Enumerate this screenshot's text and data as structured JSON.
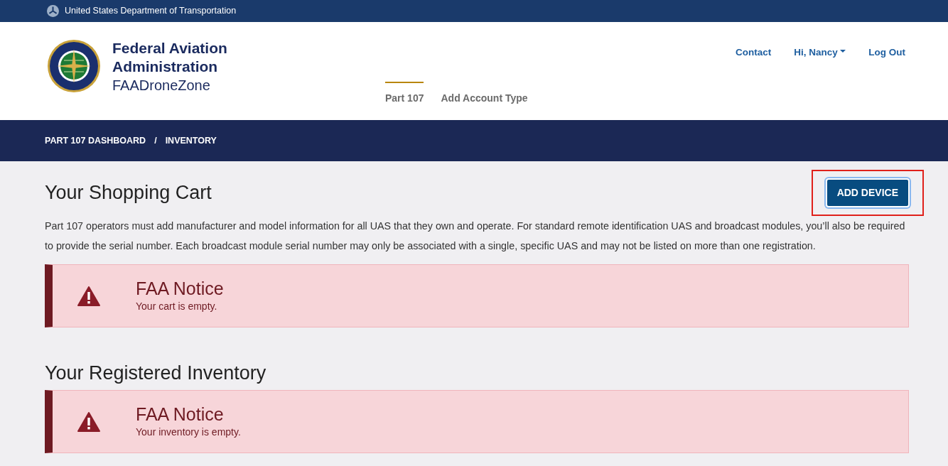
{
  "top_banner": {
    "text": "United States Department of Transportation"
  },
  "header": {
    "title_line_1": "Federal Aviation",
    "title_line_2": "Administration",
    "subtitle": "FAADroneZone",
    "utility_links": [
      {
        "label": "Contact",
        "kind": "link"
      },
      {
        "label": "Hi, Nancy",
        "kind": "dropdown"
      },
      {
        "label": "Log Out",
        "kind": "link"
      }
    ],
    "tabs": [
      {
        "label": "Part 107",
        "selected": true
      },
      {
        "label": "Add Account Type",
        "selected": false
      }
    ]
  },
  "breadcrumb": [
    {
      "label": "PART 107 DASHBOARD"
    },
    {
      "label": "INVENTORY"
    }
  ],
  "breadcrumb_separator": "/",
  "shopping_cart": {
    "heading": "Your Shopping Cart",
    "button": {
      "label": "ADD DEVICE",
      "highlighted": true
    },
    "description": "Part 107 operators must add manufacturer and model information for all UAS that they own and operate. For standard remote identification UAS and broadcast modules, you’ll also be required to provide the serial number. Each broadcast module serial number may only be associated with a single, specific UAS and may not be listed on more than one registration.",
    "notice": {
      "title": "FAA Notice",
      "message": "Your cart is empty."
    }
  },
  "registered_inventory": {
    "heading": "Your Registered Inventory",
    "notice": {
      "title": "FAA Notice",
      "message": "Your inventory is empty."
    }
  }
}
